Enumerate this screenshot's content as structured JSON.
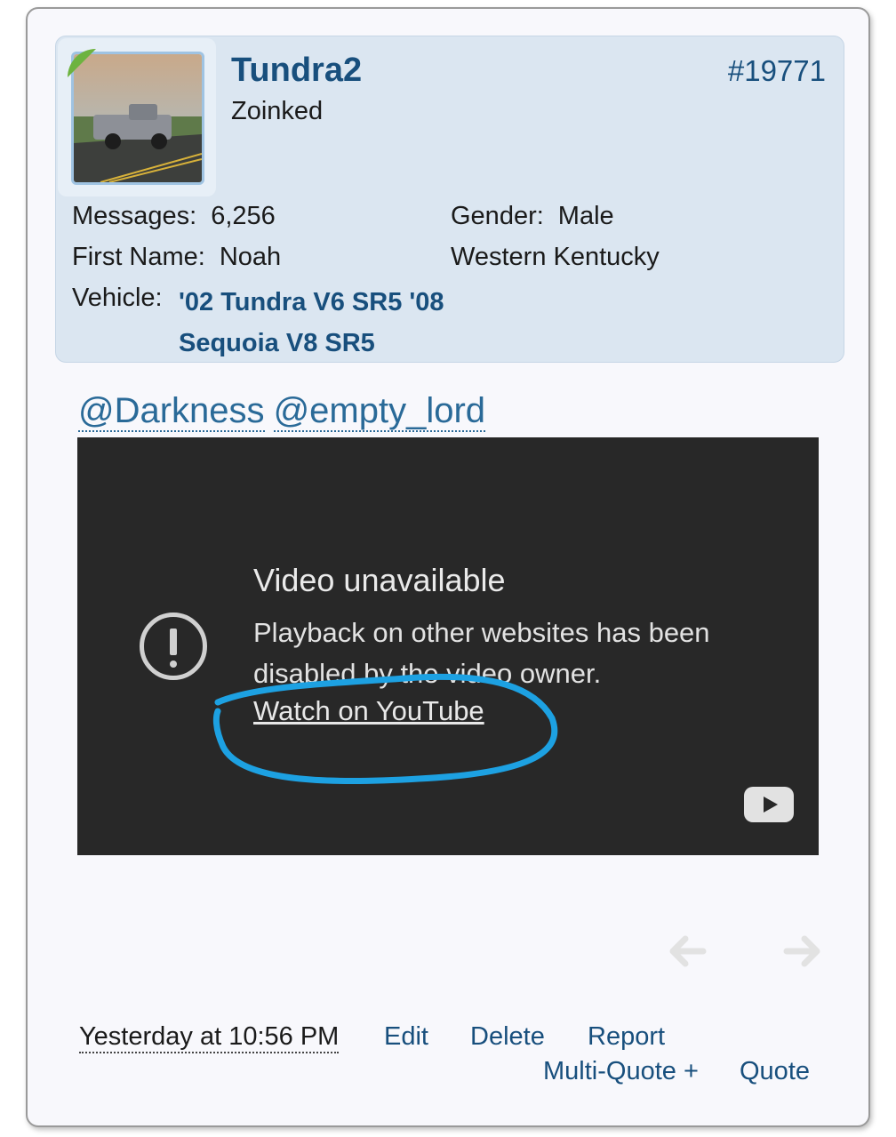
{
  "user": {
    "username": "Tundra2",
    "title": "Zoinked",
    "post_number": "#19771"
  },
  "stats": {
    "messages_label": "Messages:",
    "messages_value": "6,256",
    "gender_label": "Gender:",
    "gender_value": "Male",
    "first_name_label": "First Name:",
    "first_name_value": "Noah",
    "location": "Western Kentucky",
    "vehicle_label": "Vehicle:",
    "vehicle_value": "'02 Tundra V6 SR5 '08 Sequoia V8 SR5"
  },
  "post": {
    "mentions": [
      "@Darkness",
      "@empty_lord"
    ]
  },
  "video": {
    "title": "Video unavailable",
    "message": "Playback on other websites has been disabled by the video owner.",
    "link": "Watch on YouTube",
    "icons": [
      "warning-icon",
      "youtube-logo-icon"
    ],
    "annotation_color": "#1da1e2"
  },
  "footer": {
    "timestamp": "Yesterday at 10:56 PM",
    "edit": "Edit",
    "delete": "Delete",
    "report": "Report",
    "multi_quote": "Multi-Quote +",
    "quote": "Quote"
  },
  "colors": {
    "link": "#184f7d",
    "userblock_bg": "#dbe6f1",
    "video_bg": "#282828"
  }
}
